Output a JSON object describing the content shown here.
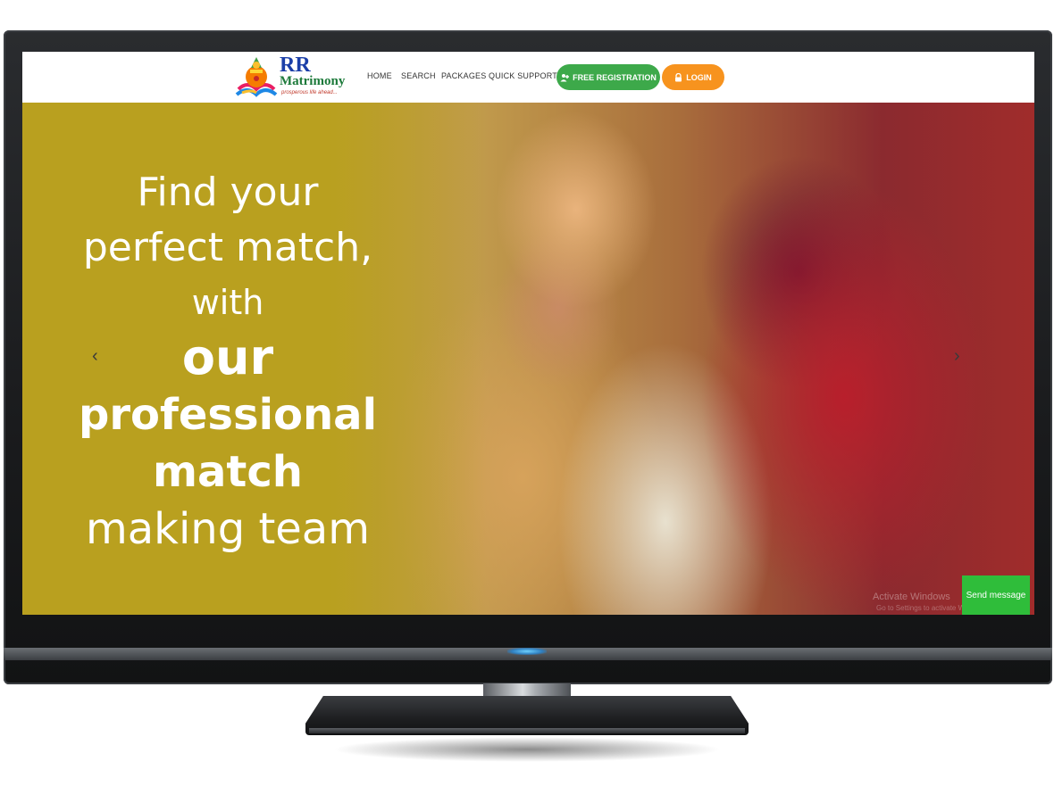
{
  "brand": {
    "name_line1": "RR",
    "name_line2": "Matrimony",
    "tagline": "prosperous life ahead..."
  },
  "nav": {
    "items": [
      "HOME",
      "SEARCH",
      "PACKAGES",
      "QUICK SUPPORT"
    ],
    "register_label": "FREE REGISTRATION",
    "login_label": "LOGIN"
  },
  "hero": {
    "lines": [
      "Find your",
      "perfect match,",
      "with",
      "our",
      "professional",
      "match",
      "making team"
    ],
    "prev_arrow": "‹",
    "next_arrow": "›"
  },
  "overlay": {
    "watermark": "Activate Windows",
    "watermark_sub": "Go to Settings to activate Windows.",
    "send_message": "Send message"
  },
  "colors": {
    "hero_gold": "#b9a01f",
    "register_green": "#3da94a",
    "login_orange": "#f7931e",
    "send_green": "#2fbd3a",
    "brand_blue": "#1b3fa8",
    "brand_green": "#1d7a3b"
  },
  "icons": {
    "logo": "kalash-logo-icon",
    "register": "user-plus-icon",
    "login": "lock-icon",
    "dropdown": "caret-down-icon"
  }
}
